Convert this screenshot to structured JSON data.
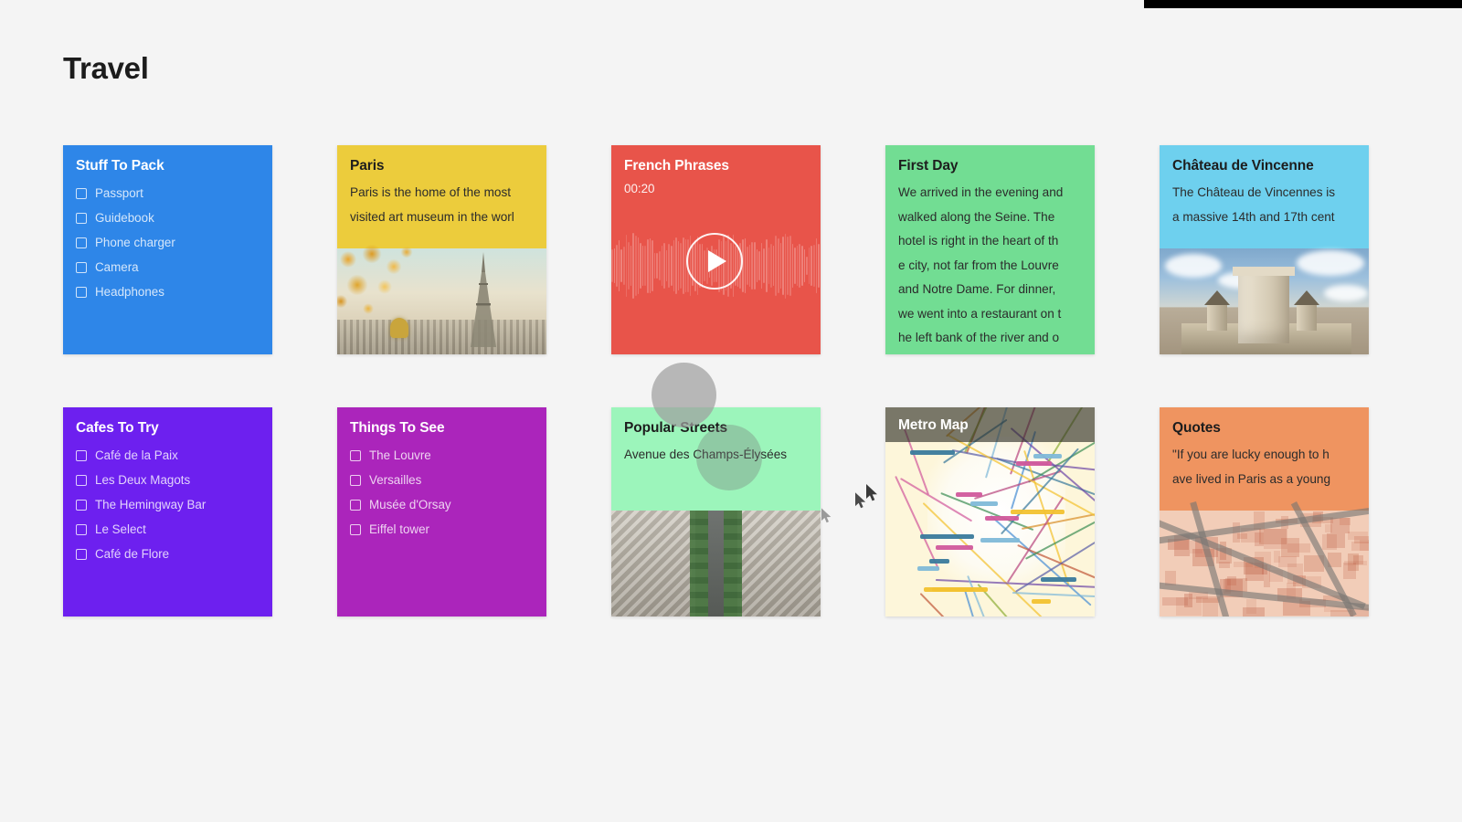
{
  "page": {
    "title": "Travel",
    "background_color": "#f4f4f4"
  },
  "topbar": {
    "color": "#000000"
  },
  "cards": [
    {
      "id": "stuff-to-pack",
      "kind": "checklist",
      "title": "Stuff To Pack",
      "color": "#2e86e8",
      "items": [
        "Passport",
        "Guidebook",
        "Phone charger",
        "Camera",
        "Headphones"
      ]
    },
    {
      "id": "paris",
      "kind": "note-photo",
      "title": "Paris",
      "color": "#eccc3c",
      "body_lines": [
        "Paris is the home of the most",
        "visited art museum in the worl"
      ],
      "photo": "eiffel-tower-autumn"
    },
    {
      "id": "french-phrases",
      "kind": "audio",
      "title": "French Phrases",
      "color": "#e8544a",
      "duration": "00:20",
      "play_icon": "play-icon"
    },
    {
      "id": "first-day",
      "kind": "note",
      "title": "First Day",
      "color": "#72dd93",
      "body_lines": [
        "We arrived in the evening and",
        " walked along the Seine. The",
        "hotel is right in the heart of th",
        "e city, not far from the Louvre",
        "and Notre Dame. For dinner,",
        "we went into a restaurant on t",
        "he left bank of the river and o"
      ]
    },
    {
      "id": "chateau-de-vincennes",
      "kind": "note-photo",
      "title": "Château de Vincenne",
      "color": "#6ed0ee",
      "body_lines": [
        "The Château de Vincennes is",
        "a massive 14th and 17th cent"
      ],
      "photo": "chateau-de-vincennes"
    },
    {
      "id": "cafes-to-try",
      "kind": "checklist",
      "title": "Cafes To Try",
      "color": "#6d20ef",
      "items": [
        "Café de la Paix",
        "Les Deux Magots",
        "The Hemingway Bar",
        "Le Select",
        "Café de Flore"
      ]
    },
    {
      "id": "things-to-see",
      "kind": "checklist",
      "title": "Things To See",
      "color": "#ab25bb",
      "items": [
        "The Louvre",
        "Versailles",
        "Musée d'Orsay",
        "Eiffel tower"
      ]
    },
    {
      "id": "popular-streets",
      "kind": "note-photo",
      "title": "Popular Streets",
      "color": "#9cf5bb",
      "body_lines": [
        "Avenue des Champs-Élysées"
      ],
      "photo": "champs-elysees"
    },
    {
      "id": "metro-map",
      "kind": "photo-overlay",
      "title": "Metro Map",
      "color": "#fdf6da",
      "photo": "paris-metro-map"
    },
    {
      "id": "quotes",
      "kind": "note-photo",
      "title": "Quotes",
      "color": "#ef9460",
      "body_lines": [
        "\"If you are lucky enough to h",
        "ave lived in Paris as a young"
      ],
      "photo": "old-paris-street-map"
    }
  ],
  "overlays": {
    "circles": [
      {
        "name": "drag-ghost-circle-top",
        "color": "#a0a0a0"
      },
      {
        "name": "drag-ghost-circle-mid",
        "color": "#787878"
      }
    ],
    "cursors": [
      {
        "name": "mouse-cursor-primary"
      },
      {
        "name": "mouse-cursor-secondary"
      },
      {
        "name": "mouse-cursor-metro"
      }
    ]
  }
}
